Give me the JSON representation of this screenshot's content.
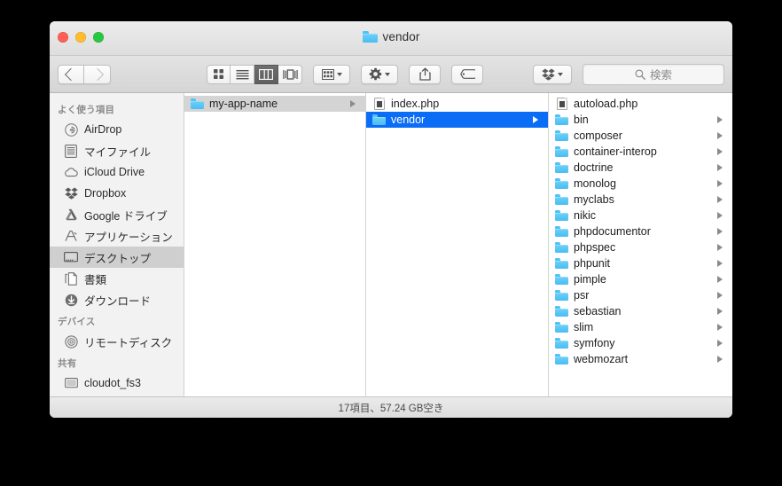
{
  "window": {
    "title": "vendor",
    "title_icon": "folder-icon"
  },
  "traffic_lights": {
    "close_label": "close",
    "minimize_label": "minimize",
    "zoom_label": "zoom",
    "close_color": "#ff5f57",
    "minimize_color": "#ffbd2e",
    "zoom_color": "#28c840"
  },
  "toolbar": {
    "back_label": "戻る",
    "forward_label": "進む",
    "view_modes": [
      {
        "name": "icon-view",
        "label": "アイコン表示",
        "active": false
      },
      {
        "name": "list-view",
        "label": "リスト表示",
        "active": false
      },
      {
        "name": "column-view",
        "label": "カラム表示",
        "active": true
      },
      {
        "name": "gallery-view",
        "label": "ギャラリー表示",
        "active": false
      }
    ],
    "arrange_label": "グループ分け",
    "action_label": "操作",
    "share_label": "共有",
    "tag_label": "タグ",
    "dropbox_label": "Dropbox"
  },
  "search": {
    "placeholder": "検索",
    "value": "",
    "icon": "search-icon"
  },
  "sidebar": {
    "sections": [
      {
        "header": "よく使う項目",
        "items": [
          {
            "label": "AirDrop",
            "icon": "airdrop-icon",
            "selected": false
          },
          {
            "label": "マイファイル",
            "icon": "allmyfiles-icon",
            "selected": false
          },
          {
            "label": "iCloud Drive",
            "icon": "icloud-icon",
            "selected": false
          },
          {
            "label": "Dropbox",
            "icon": "dropbox-icon",
            "selected": false
          },
          {
            "label": "Google ドライブ",
            "icon": "googledrive-icon",
            "selected": false
          },
          {
            "label": "アプリケーション",
            "icon": "applications-icon",
            "selected": false
          },
          {
            "label": "デスクトップ",
            "icon": "desktop-icon",
            "selected": true
          },
          {
            "label": "書類",
            "icon": "documents-icon",
            "selected": false
          },
          {
            "label": "ダウンロード",
            "icon": "downloads-icon",
            "selected": false
          }
        ]
      },
      {
        "header": "デバイス",
        "items": [
          {
            "label": "リモートディスク",
            "icon": "remotedisc-icon",
            "selected": false
          }
        ]
      },
      {
        "header": "共有",
        "items": [
          {
            "label": "cloudot_fs3",
            "icon": "server-icon",
            "selected": false
          }
        ]
      }
    ]
  },
  "columns": [
    {
      "name": "column-1",
      "rows": [
        {
          "label": "my-app-name",
          "type": "folder",
          "selection": "gray",
          "has_disclosure": true
        }
      ]
    },
    {
      "name": "column-2",
      "rows": [
        {
          "label": "index.php",
          "type": "file",
          "selection": "none",
          "has_disclosure": false
        },
        {
          "label": "vendor",
          "type": "folder",
          "selection": "blue",
          "has_disclosure": true
        }
      ]
    },
    {
      "name": "column-3",
      "rows": [
        {
          "label": "autoload.php",
          "type": "file",
          "selection": "none",
          "has_disclosure": false
        },
        {
          "label": "bin",
          "type": "folder",
          "selection": "none",
          "has_disclosure": true
        },
        {
          "label": "composer",
          "type": "folder",
          "selection": "none",
          "has_disclosure": true
        },
        {
          "label": "container-interop",
          "type": "folder",
          "selection": "none",
          "has_disclosure": true
        },
        {
          "label": "doctrine",
          "type": "folder",
          "selection": "none",
          "has_disclosure": true
        },
        {
          "label": "monolog",
          "type": "folder",
          "selection": "none",
          "has_disclosure": true
        },
        {
          "label": "myclabs",
          "type": "folder",
          "selection": "none",
          "has_disclosure": true
        },
        {
          "label": "nikic",
          "type": "folder",
          "selection": "none",
          "has_disclosure": true
        },
        {
          "label": "phpdocumentor",
          "type": "folder",
          "selection": "none",
          "has_disclosure": true
        },
        {
          "label": "phpspec",
          "type": "folder",
          "selection": "none",
          "has_disclosure": true
        },
        {
          "label": "phpunit",
          "type": "folder",
          "selection": "none",
          "has_disclosure": true
        },
        {
          "label": "pimple",
          "type": "folder",
          "selection": "none",
          "has_disclosure": true
        },
        {
          "label": "psr",
          "type": "folder",
          "selection": "none",
          "has_disclosure": true
        },
        {
          "label": "sebastian",
          "type": "folder",
          "selection": "none",
          "has_disclosure": true
        },
        {
          "label": "slim",
          "type": "folder",
          "selection": "none",
          "has_disclosure": true
        },
        {
          "label": "symfony",
          "type": "folder",
          "selection": "none",
          "has_disclosure": true
        },
        {
          "label": "webmozart",
          "type": "folder",
          "selection": "none",
          "has_disclosure": true
        }
      ]
    }
  ],
  "statusbar": {
    "text": "17項目、57.24 GB空き"
  },
  "colors": {
    "selection_blue": "#0b6cf5",
    "selection_gray": "#d4d4d4",
    "folder_blue": "#49bdf2",
    "sidebar_bg": "#f2f2f2"
  }
}
